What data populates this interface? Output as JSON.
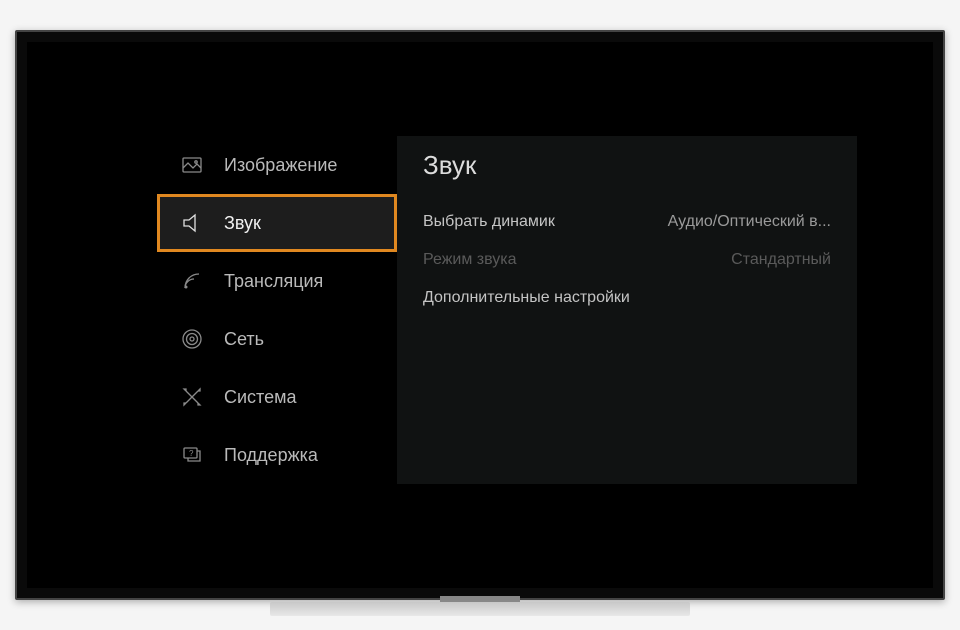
{
  "sidebar": {
    "items": [
      {
        "label": "Изображение",
        "icon": "image-icon",
        "selected": false
      },
      {
        "label": "Звук",
        "icon": "speaker-icon",
        "selected": true
      },
      {
        "label": "Трансляция",
        "icon": "broadcast-icon",
        "selected": false
      },
      {
        "label": "Сеть",
        "icon": "network-icon",
        "selected": false
      },
      {
        "label": "Система",
        "icon": "system-icon",
        "selected": false
      },
      {
        "label": "Поддержка",
        "icon": "support-icon",
        "selected": false
      }
    ]
  },
  "content": {
    "title": "Звук",
    "settings": [
      {
        "label": "Выбрать динамик",
        "value": "Аудио/Оптический в...",
        "disabled": false
      },
      {
        "label": "Режим звука",
        "value": "Стандартный",
        "disabled": true
      },
      {
        "label": "Дополнительные настройки",
        "value": "",
        "disabled": false
      }
    ]
  },
  "colors": {
    "highlight": "#e08820",
    "panel": "#101212"
  }
}
